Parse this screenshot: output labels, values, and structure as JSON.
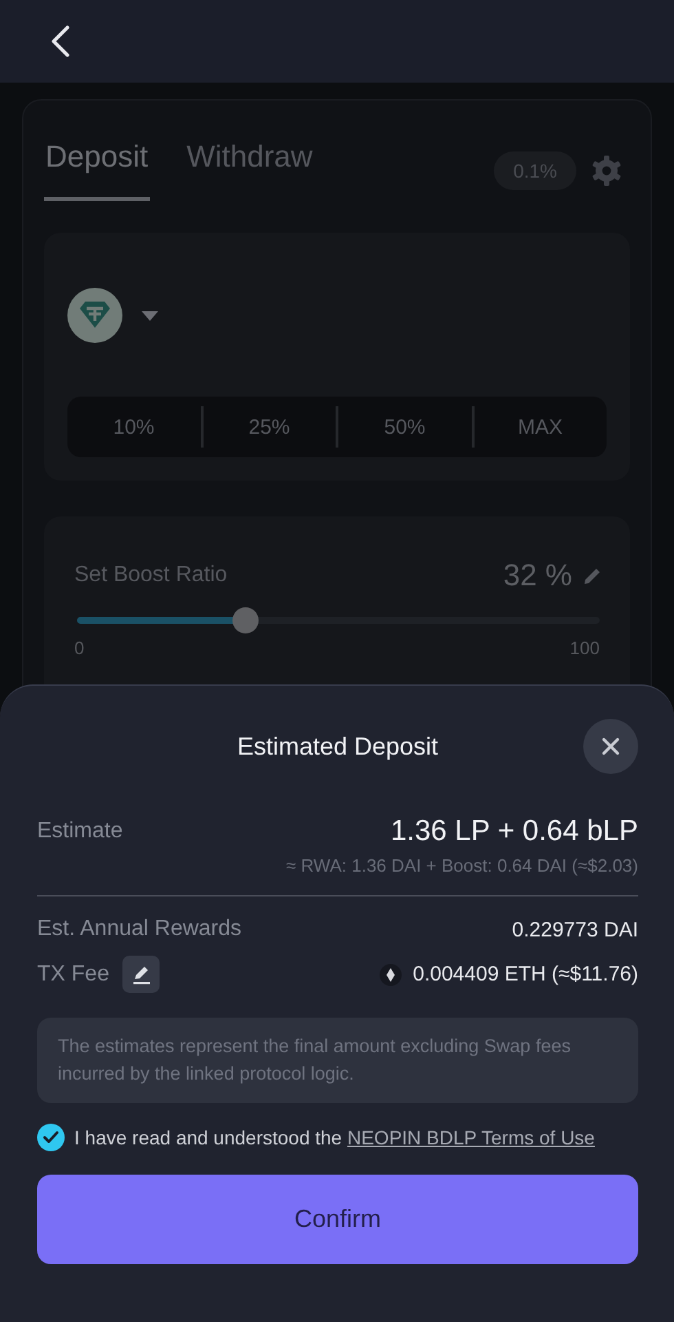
{
  "tabs": [
    {
      "label": "Deposit",
      "selected": true
    },
    {
      "label": "Withdraw",
      "selected": false
    }
  ],
  "slippage": "0.1%",
  "percent_buttons": [
    "10%",
    "25%",
    "50%",
    "MAX"
  ],
  "boost": {
    "label": "Set Boost Ratio",
    "reading": "32 %",
    "level": 0.32,
    "min": "0",
    "max": "100"
  },
  "sheet": {
    "title": "Estimated Deposit",
    "estimate": {
      "label": "Estimate",
      "value": "1.36 LP + 0.64 bLP",
      "detail": "≈ RWA: 1.36 DAI + Boost: 0.64 DAI (≈$2.03)"
    },
    "annual_rewards": {
      "label": "Est. Annual Rewards",
      "value": "0.229773 DAI"
    },
    "tx_fee": {
      "label": "TX Fee",
      "value": "0.004409 ETH (≈$11.76)"
    },
    "note": "The estimates represent the final amount excluding Swap fees incurred by the linked protocol logic.",
    "agreement": {
      "checked": true,
      "text": "I have read and understood the",
      "link": "NEOPIN BDLP Terms of Use"
    },
    "confirm": "Confirm"
  }
}
